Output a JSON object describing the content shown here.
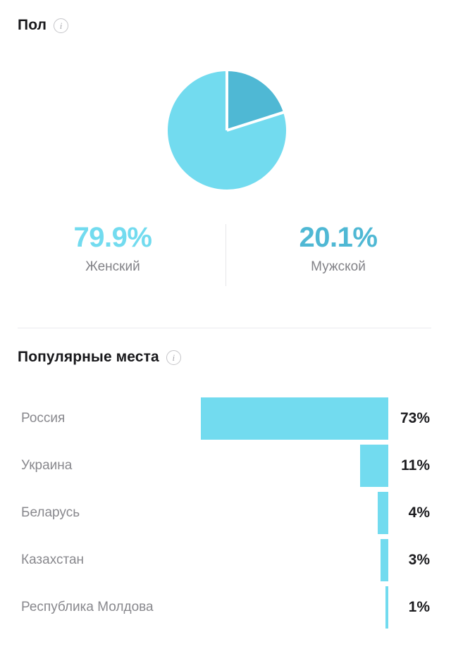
{
  "gender": {
    "heading": "Пол",
    "info_icon": "info-icon",
    "info_glyph": "i",
    "stats": [
      {
        "value": "79.9%",
        "label": "Женский",
        "color": "#72dbef"
      },
      {
        "value": "20.1%",
        "label": "Мужской",
        "color": "#4fb8d4"
      }
    ]
  },
  "places": {
    "heading": "Популярные места",
    "info_icon": "info-icon",
    "info_glyph": "i"
  },
  "chart_data": [
    {
      "type": "pie",
      "title": "Пол",
      "labels": [
        "Женский",
        "Мужской"
      ],
      "values": [
        79.9,
        20.1
      ],
      "colors": [
        "#72dbef",
        "#4fb8d4"
      ],
      "start_angle_deg": 0,
      "direction": "clockwise",
      "slice_gap": true,
      "legend": "below",
      "units": "%"
    },
    {
      "type": "bar",
      "orientation": "horizontal",
      "title": "Популярные места",
      "categories": [
        "Россия",
        "Украина",
        "Беларусь",
        "Казахстан",
        "Республика Молдова"
      ],
      "values": [
        73,
        11,
        4,
        3,
        1
      ],
      "value_labels": [
        "73%",
        "11%",
        "4%",
        "3%",
        "1%"
      ],
      "xlabel": "",
      "ylabel": "",
      "xlim": [
        0,
        73
      ],
      "grid": false,
      "bar_color": "#72dbef",
      "bar_align": "right",
      "units": "%"
    }
  ]
}
